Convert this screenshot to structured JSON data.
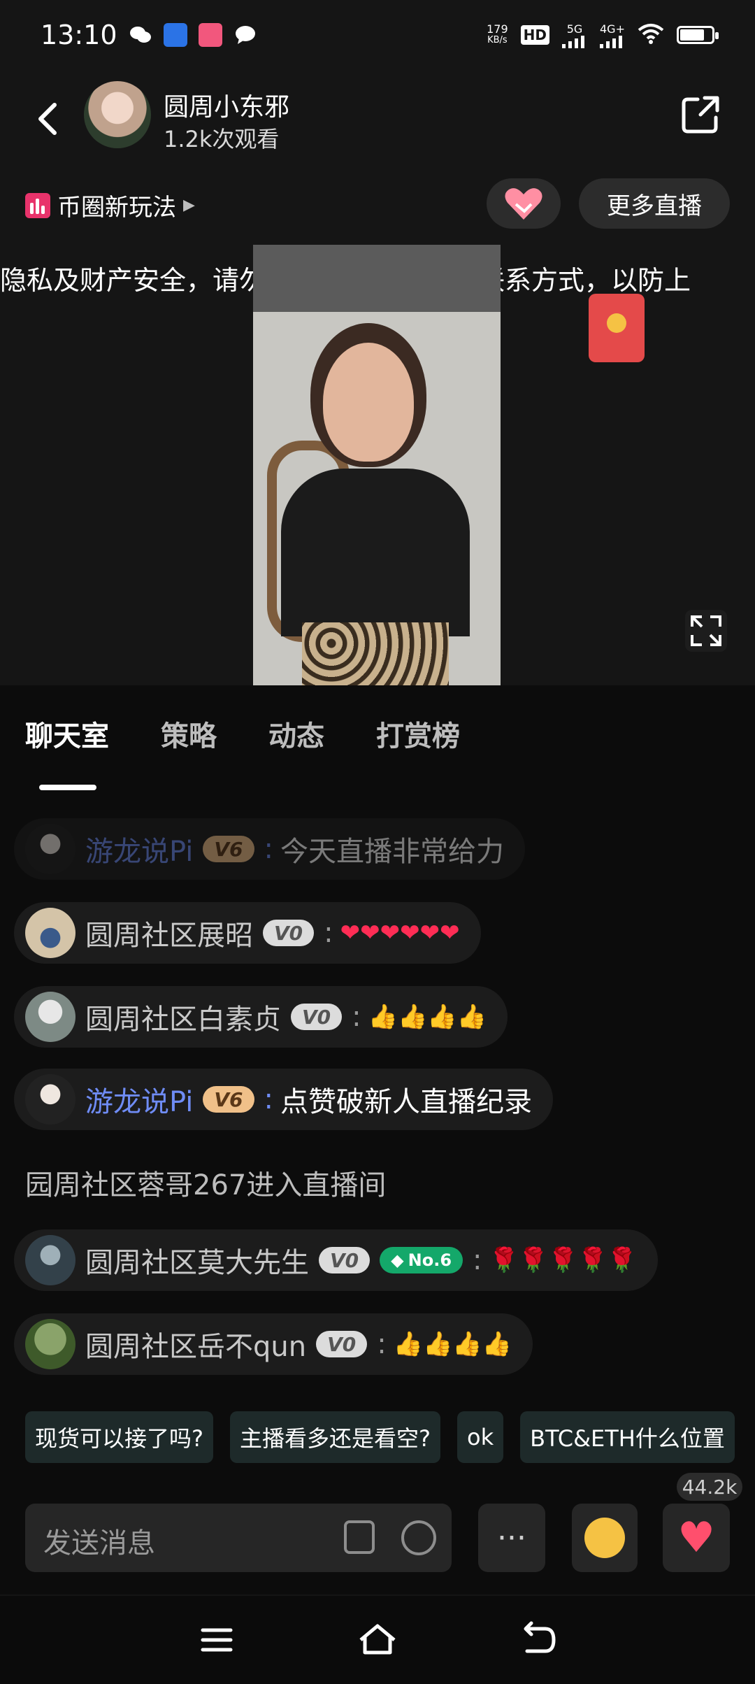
{
  "status_bar": {
    "time": "13:10",
    "net_speed_top": "179",
    "net_speed_unit": "KB/s",
    "hd": "HD",
    "gen1": "5G",
    "gen2": "4G+"
  },
  "header": {
    "anchor_name": "圆周小东邪",
    "viewers": "1.2k次观看"
  },
  "topic": {
    "label": "币圈新玩法",
    "more_live": "更多直播"
  },
  "notice": "隐私及财产安全，请勿在评论区发布任何联系方式，以防上",
  "tabs": [
    "聊天室",
    "策略",
    "动态",
    "打赏榜"
  ],
  "messages": [
    {
      "name": "游龙说Pi",
      "level": "V6",
      "content": "今天直播非常给力"
    },
    {
      "name": "圆周社区展昭",
      "level": "V0",
      "content": "❤❤❤❤❤❤"
    },
    {
      "name": "圆周社区白素贞",
      "level": "V0",
      "content": "👍👍👍👍"
    },
    {
      "name": "游龙说Pi",
      "level": "V6",
      "content": "点赞破新人直播纪录"
    },
    {
      "system": "园周社区蓉哥267进入直播间"
    },
    {
      "name": "圆周社区莫大先生",
      "level": "V0",
      "rank": "No.6",
      "content": "🌹🌹🌹🌹🌹"
    },
    {
      "name": "圆周社区岳不qun",
      "level": "V0",
      "content": "👍👍👍👍"
    }
  ],
  "quick_replies": [
    "现货可以接了吗?",
    "主播看多还是看空?",
    "ok",
    "BTC&ETH什么位置"
  ],
  "input": {
    "placeholder": "发送消息",
    "more": "···",
    "like_count": "44.2k"
  },
  "colors": {
    "accent_blue": "#6f8cf5",
    "v6_badge": "#f0c089",
    "rank_badge": "#14a86a",
    "heart": "#ff4f6d"
  }
}
